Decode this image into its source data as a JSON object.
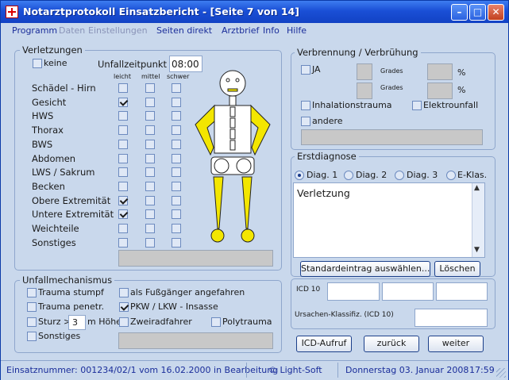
{
  "window": {
    "title": "Notarztprotokoll Einsatzbericht - [Seite 7 von 14]"
  },
  "menu": [
    {
      "label": "Programm",
      "enabled": true
    },
    {
      "label": "Daten",
      "enabled": false
    },
    {
      "label": "Einstellungen",
      "enabled": false
    },
    {
      "label": "Seiten direkt",
      "enabled": true
    },
    {
      "label": "Arztbrief",
      "enabled": true
    },
    {
      "label": "Info",
      "enabled": true
    },
    {
      "label": "Hilfe",
      "enabled": true
    }
  ],
  "verletzungen": {
    "title": "Verletzungen",
    "keine": {
      "label": "keine",
      "checked": false
    },
    "unfallzeit_label": "Unfallzeitpunkt",
    "unfallzeit_value": "08:00",
    "severity_headers": [
      "leicht",
      "mittel",
      "schwer"
    ],
    "rows": [
      {
        "label": "Schädel - Hirn",
        "checked": [
          false,
          false,
          false
        ]
      },
      {
        "label": "Gesicht",
        "checked": [
          true,
          false,
          false
        ]
      },
      {
        "label": "HWS",
        "checked": [
          false,
          false,
          false
        ]
      },
      {
        "label": "Thorax",
        "checked": [
          false,
          false,
          false
        ]
      },
      {
        "label": "BWS",
        "checked": [
          false,
          false,
          false
        ]
      },
      {
        "label": "Abdomen",
        "checked": [
          false,
          false,
          false
        ]
      },
      {
        "label": "LWS / Sakrum",
        "checked": [
          false,
          false,
          false
        ]
      },
      {
        "label": "Becken",
        "checked": [
          false,
          false,
          false
        ]
      },
      {
        "label": "Obere Extremität",
        "checked": [
          true,
          false,
          false
        ]
      },
      {
        "label": "Untere Extremität",
        "checked": [
          true,
          false,
          false
        ]
      },
      {
        "label": "Weichteile",
        "checked": [
          false,
          false,
          false
        ]
      },
      {
        "label": "Sonstiges",
        "checked": [
          false,
          false,
          false
        ]
      }
    ]
  },
  "verbrennung": {
    "title": "Verbrennung / Verbrühung",
    "ja": "JA",
    "grades1": "Grades",
    "grades2": "Grades",
    "percent1": "%",
    "percent2": "%",
    "inhalation": "Inhalationstrauma",
    "elektro": "Elektrounfall",
    "andere": "andere"
  },
  "erstdiagnose": {
    "title": "Erstdiagnose",
    "tabs": [
      {
        "label": "Diag. 1",
        "selected": true
      },
      {
        "label": "Diag. 2",
        "selected": false
      },
      {
        "label": "Diag. 3",
        "selected": false
      },
      {
        "label": "E-Klas.",
        "selected": false
      }
    ],
    "text": "Verletzung",
    "standard_button": "Standardeintrag auswählen...",
    "loeschen_button": "Löschen"
  },
  "unfallmechanismus": {
    "title": "Unfallmechanismus",
    "trauma_stumpf": "Trauma stumpf",
    "trauma_penetr": "Trauma penetr.",
    "sturz_label": "Sturz >",
    "sturz_value": "3",
    "sturz_unit": "m Höhe",
    "sonstiges": "Sonstiges",
    "fussgaenger": "als Fußgänger angefahren",
    "pkw": "PKW / LKW - Insasse",
    "pkw_checked": true,
    "zweirad": "Zweiradfahrer",
    "polytrauma": "Polytrauma"
  },
  "icd": {
    "icd10_label": "ICD 10",
    "ursachen_label": "Ursachen-Klassifiz. (ICD 10)"
  },
  "nav": {
    "icd_button": "ICD-Aufruf",
    "back_button": "zurück",
    "next_button": "weiter"
  },
  "status": {
    "einsatz": "Einsatznummer: 001234/02/1 vom 16.02.2000 in Bearbeitung",
    "copyright": "© Light-Soft",
    "date": "Donnerstag  03.  Januar  2008",
    "time": "17:59"
  },
  "colors": {
    "titlebar": "#1a4fd6",
    "panel": "#c9d8ec",
    "figure_highlight": "#f0e000"
  }
}
